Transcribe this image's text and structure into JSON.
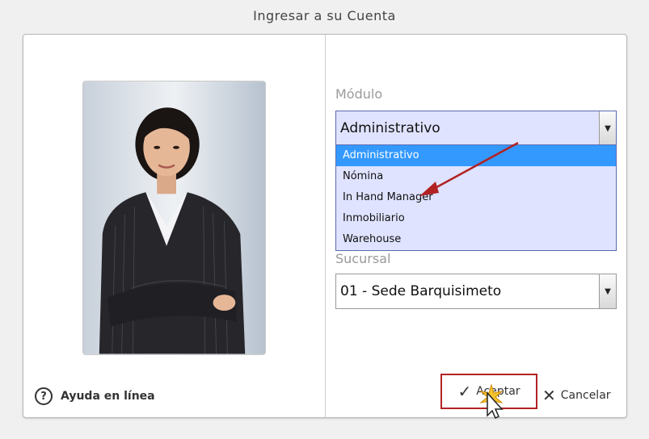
{
  "window": {
    "title": "Ingresar a su Cuenta"
  },
  "help": {
    "icon": "help-circle-icon",
    "label": "Ayuda en línea"
  },
  "form": {
    "modulo_label": "Módulo",
    "modulo_value": "Administrativo",
    "modulo_options": [
      "Administrativo",
      "Nómina",
      "In Hand Manager",
      "Inmobiliario",
      "Warehouse"
    ],
    "sucursal_label": "Sucursal",
    "sucursal_value": "01 - Sede Barquisimeto"
  },
  "buttons": {
    "accept_label": "Aceptar",
    "accept_icon": "check-icon",
    "cancel_label": "Cancelar",
    "cancel_icon": "close-icon"
  },
  "colors": {
    "select_bg": "#dfe3ff",
    "highlight": "#3399ff",
    "annotation": "#b22222"
  }
}
